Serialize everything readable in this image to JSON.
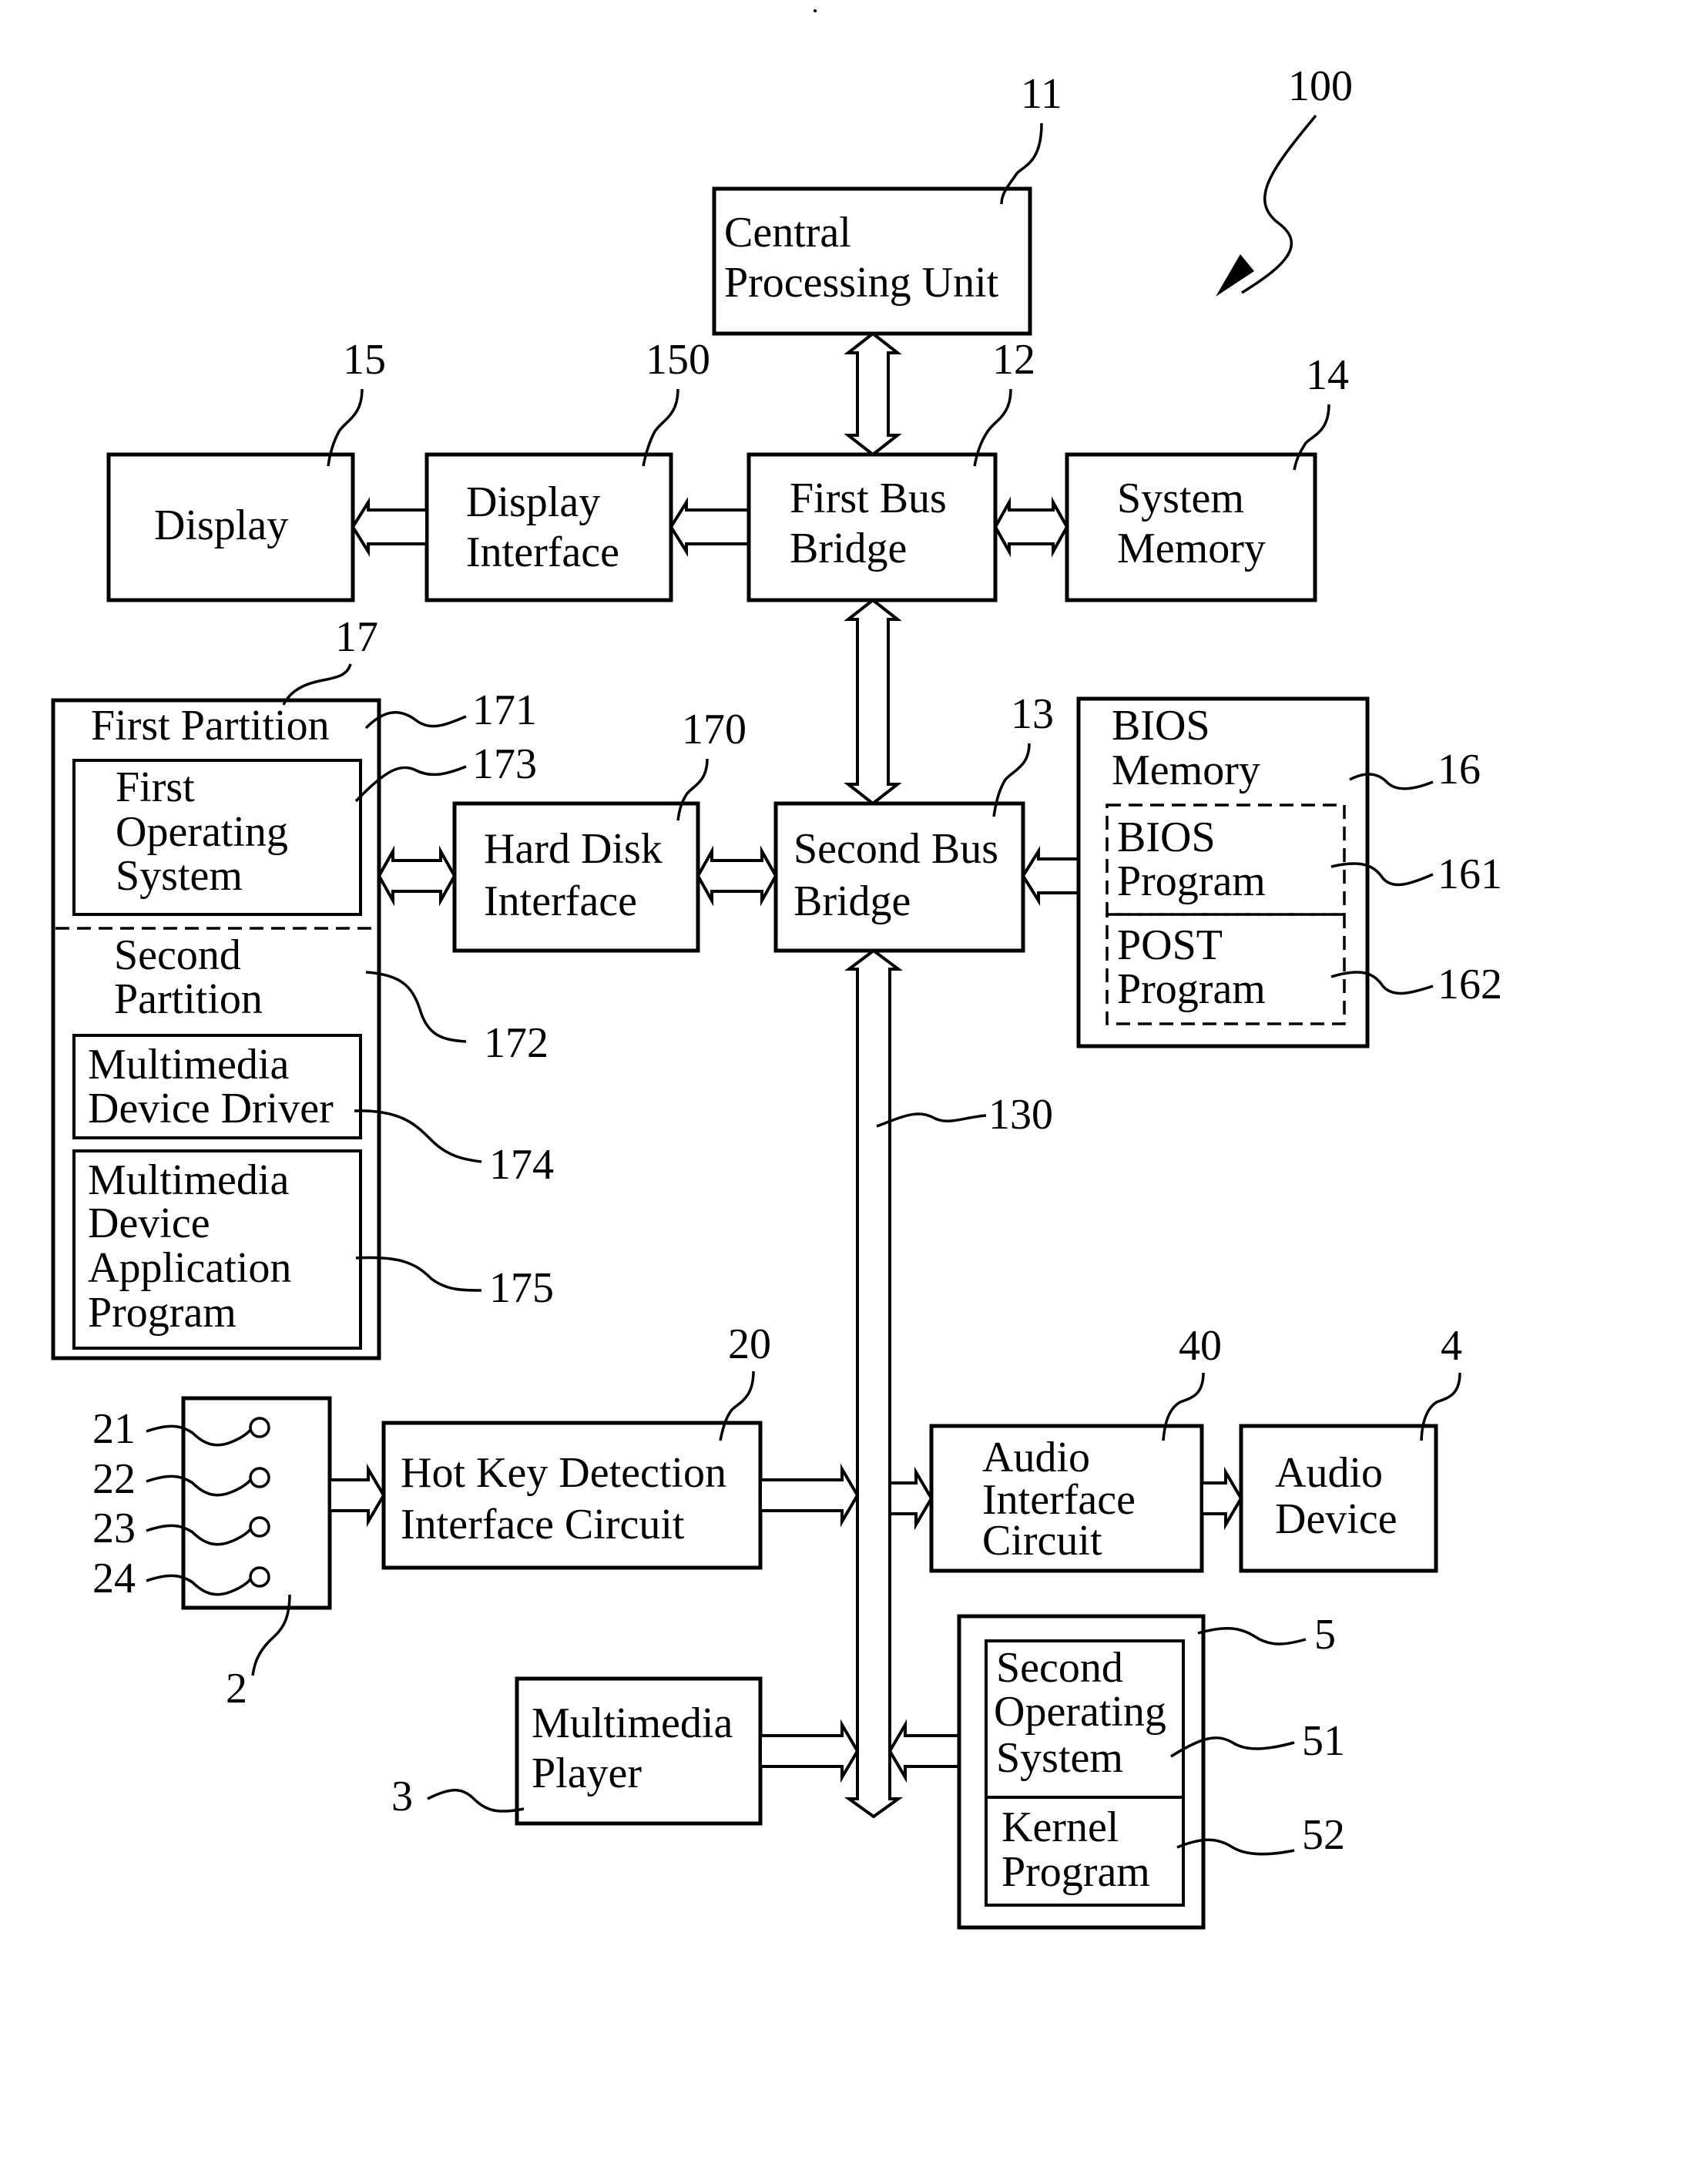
{
  "figure": {
    "ref": "100",
    "blocks": {
      "cpu": {
        "ref": "11",
        "lines": [
          "Central",
          "Processing Unit"
        ]
      },
      "first_bus_bridge": {
        "ref": "12",
        "lines": [
          "First Bus",
          "Bridge"
        ]
      },
      "second_bus_bridge": {
        "ref": "13",
        "lines": [
          "Second Bus",
          "Bridge"
        ]
      },
      "system_memory": {
        "ref": "14",
        "lines": [
          "System",
          "Memory"
        ]
      },
      "display": {
        "ref": "15",
        "lines": [
          "Display"
        ]
      },
      "display_interface": {
        "ref": "150",
        "lines": [
          "Display",
          "Interface"
        ]
      },
      "bios_memory": {
        "ref": "16",
        "lines": [
          "BIOS",
          "Memory"
        ]
      },
      "bios_program": {
        "ref": "161",
        "lines": [
          "BIOS",
          "Program"
        ]
      },
      "post_program": {
        "ref": "162",
        "lines": [
          "POST",
          "Program"
        ]
      },
      "hard_disk": {
        "ref": "17"
      },
      "first_partition": {
        "ref": "171",
        "lines": [
          "First Partition"
        ]
      },
      "second_partition": {
        "ref": "172",
        "lines": [
          "Second",
          "Partition"
        ]
      },
      "first_os": {
        "ref": "173",
        "lines": [
          "First",
          "Operating",
          "System"
        ]
      },
      "mm_driver": {
        "ref": "174",
        "lines": [
          "Multimedia",
          "Device Driver"
        ]
      },
      "mm_app": {
        "ref": "175",
        "lines": [
          "Multimedia",
          "Device",
          "Application",
          "Program"
        ]
      },
      "hdd_interface": {
        "ref": "170",
        "lines": [
          "Hard Disk",
          "Interface"
        ]
      },
      "bus": {
        "ref": "130"
      },
      "hotkey_panel": {
        "ref": "2",
        "keys": [
          "21",
          "22",
          "23",
          "24"
        ]
      },
      "hotkey_circuit": {
        "ref": "20",
        "lines": [
          "Hot Key Detection",
          "Interface Circuit"
        ]
      },
      "multimedia_player": {
        "ref": "3",
        "lines": [
          "Multimedia",
          "Player"
        ]
      },
      "audio_interface": {
        "ref": "40",
        "lines": [
          "Audio",
          "Interface",
          "Circuit"
        ]
      },
      "audio_device": {
        "ref": "4",
        "lines": [
          "Audio",
          "Device"
        ]
      },
      "storage_5": {
        "ref": "5"
      },
      "second_os": {
        "ref": "51",
        "lines": [
          "Second",
          "Operating",
          "System"
        ]
      },
      "kernel": {
        "ref": "52",
        "lines": [
          "Kernel",
          "Program"
        ]
      }
    }
  }
}
